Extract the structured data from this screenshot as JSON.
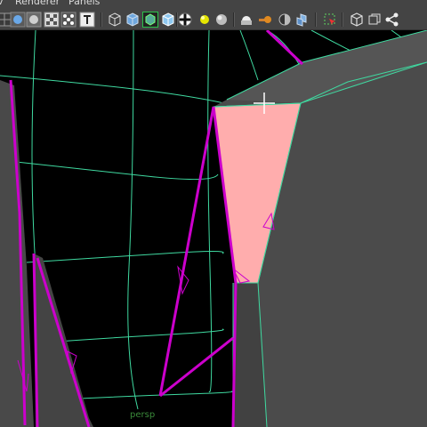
{
  "menu": {
    "view_label": "v",
    "renderer_label": "Renderer",
    "panels_label": "Panels"
  },
  "toolbar": {
    "buttons": [
      "grid-icon",
      "sphere-icon",
      "circle-icon",
      "checker-icon",
      "dots-icon",
      "text-icon",
      "wireframe-cube-icon",
      "shaded-cube-icon",
      "wireframe-on-shaded-icon",
      "xray-cube-icon",
      "checker-texture-icon",
      "light-bulb-icon",
      "shadow-sphere-icon",
      "camera-icon",
      "motion-blur-icon",
      "half-sphere-icon",
      "isolate-icon",
      "select-region-icon",
      "cube-outline-icon",
      "frame-icon",
      "share-nodes-icon"
    ]
  },
  "viewport": {
    "camera_label": "persp",
    "colors": {
      "background": "#000000",
      "grid": "#3fd9a0",
      "selected_edge": "#cc00cc",
      "selected_face": "#ffadad",
      "surface": "#4b4b4b"
    }
  }
}
